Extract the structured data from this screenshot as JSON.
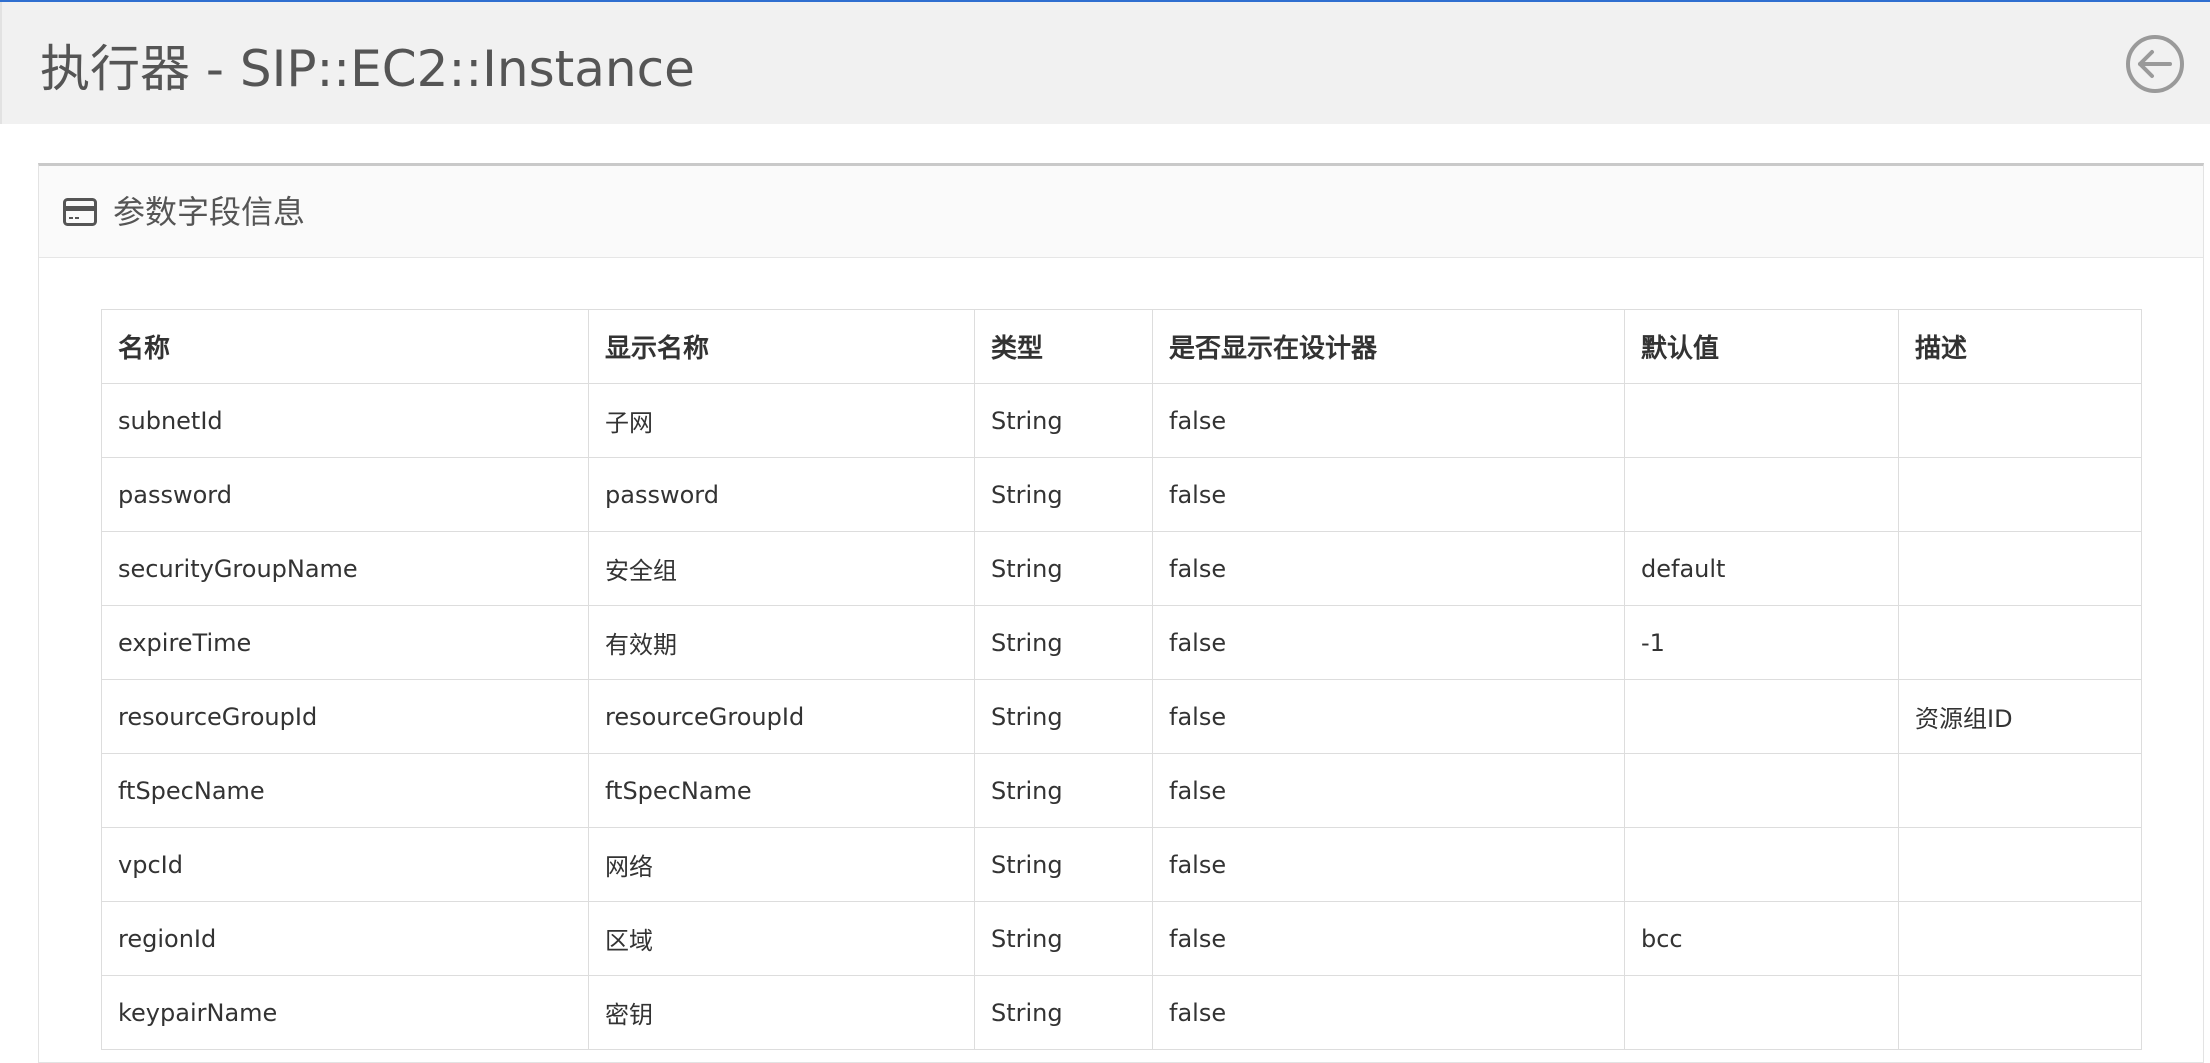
{
  "header": {
    "title": "执行器 - SIP::EC2::Instance"
  },
  "panel": {
    "title": "参数字段信息"
  },
  "table": {
    "columns": [
      "名称",
      "显示名称",
      "类型",
      "是否显示在设计器",
      "默认值",
      "描述"
    ],
    "rows": [
      [
        "subnetId",
        "子网",
        "String",
        "false",
        "",
        ""
      ],
      [
        "password",
        "password",
        "String",
        "false",
        "",
        ""
      ],
      [
        "securityGroupName",
        "安全组",
        "String",
        "false",
        "default",
        ""
      ],
      [
        "expireTime",
        "有效期",
        "String",
        "false",
        "-1",
        ""
      ],
      [
        "resourceGroupId",
        "resourceGroupId",
        "String",
        "false",
        "",
        "资源组ID"
      ],
      [
        "ftSpecName",
        "ftSpecName",
        "String",
        "false",
        "",
        ""
      ],
      [
        "vpcId",
        "网络",
        "String",
        "false",
        "",
        ""
      ],
      [
        "regionId",
        "区域",
        "String",
        "false",
        "bcc",
        ""
      ],
      [
        "keypairName",
        "密钥",
        "String",
        "false",
        "",
        ""
      ]
    ]
  },
  "icons": {
    "back": "arrow-circle-left-icon",
    "panel": "credit-card-icon"
  },
  "colors": {
    "accent": "#2f6fd0",
    "header_bg": "#f1f1f1",
    "text": "#333333"
  }
}
